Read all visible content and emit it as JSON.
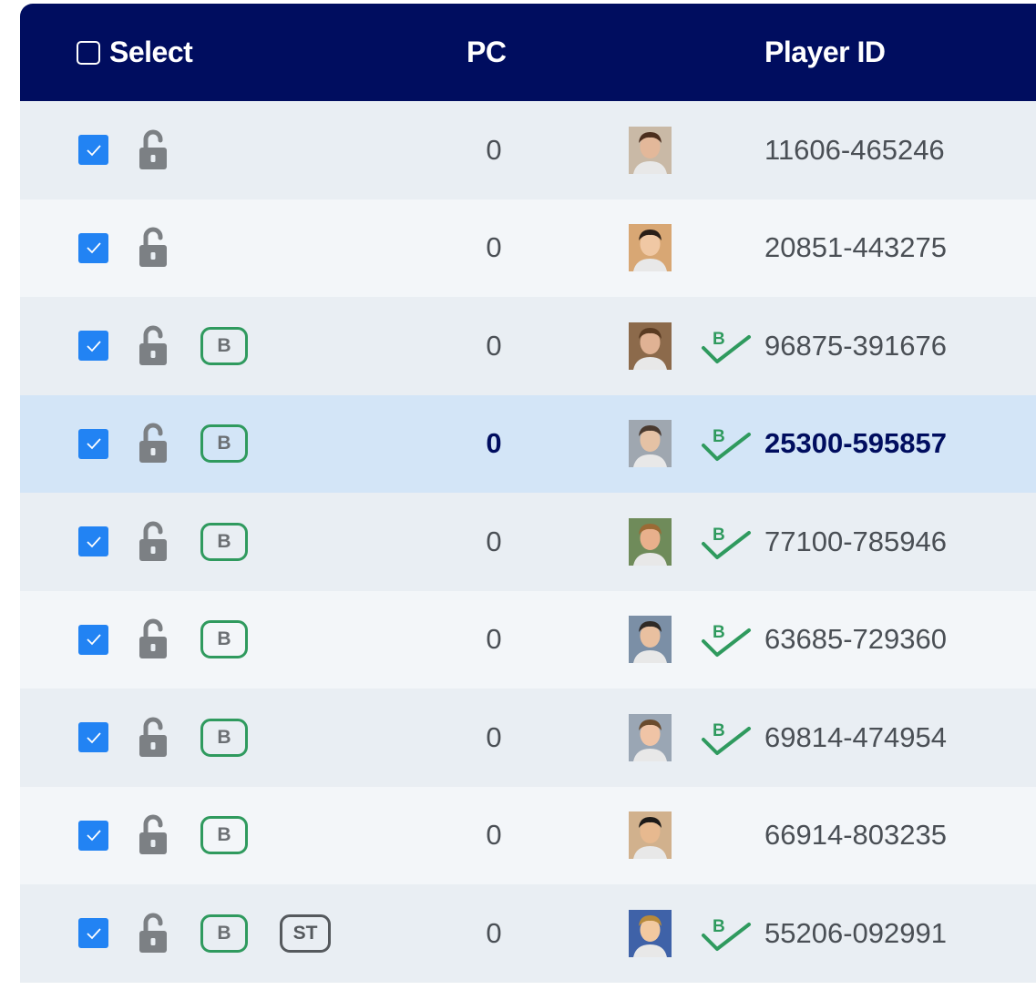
{
  "header": {
    "select_label": "Select",
    "pc_label": "PC",
    "player_id_label": "Player ID"
  },
  "colors": {
    "header_bg": "#000d5f",
    "checkbox_blue": "#2283f3",
    "badge_green": "#2f9a5e",
    "selected_row": "#d3e5f7"
  },
  "rows": [
    {
      "pc": "0",
      "player_id": "11606-465246",
      "badge_b": false,
      "badge_st": false,
      "verified": false,
      "selected": false,
      "avatar": "player-photo-1"
    },
    {
      "pc": "0",
      "player_id": "20851-443275",
      "badge_b": false,
      "badge_st": false,
      "verified": false,
      "selected": false,
      "avatar": "player-photo-2"
    },
    {
      "pc": "0",
      "player_id": "96875-391676",
      "badge_b": true,
      "badge_st": false,
      "verified": true,
      "selected": false,
      "avatar": "player-photo-3"
    },
    {
      "pc": "0",
      "player_id": "25300-595857",
      "badge_b": true,
      "badge_st": false,
      "verified": true,
      "selected": true,
      "avatar": "player-photo-4"
    },
    {
      "pc": "0",
      "player_id": "77100-785946",
      "badge_b": true,
      "badge_st": false,
      "verified": true,
      "selected": false,
      "avatar": "player-photo-5"
    },
    {
      "pc": "0",
      "player_id": "63685-729360",
      "badge_b": true,
      "badge_st": false,
      "verified": true,
      "selected": false,
      "avatar": "player-photo-6"
    },
    {
      "pc": "0",
      "player_id": "69814-474954",
      "badge_b": true,
      "badge_st": false,
      "verified": true,
      "selected": false,
      "avatar": "player-photo-7"
    },
    {
      "pc": "0",
      "player_id": "66914-803235",
      "badge_b": true,
      "badge_st": false,
      "verified": false,
      "selected": false,
      "avatar": "player-photo-8"
    },
    {
      "pc": "0",
      "player_id": "55206-092991",
      "badge_b": true,
      "badge_st": true,
      "verified": true,
      "selected": false,
      "avatar": "player-photo-9"
    }
  ],
  "badges": {
    "b_label": "B",
    "st_label": "ST",
    "verified_letter": "B"
  },
  "icons": {
    "lock": "unlocked-padlock-icon",
    "checkbox": "checkmark-icon",
    "verified": "b-check-icon"
  }
}
